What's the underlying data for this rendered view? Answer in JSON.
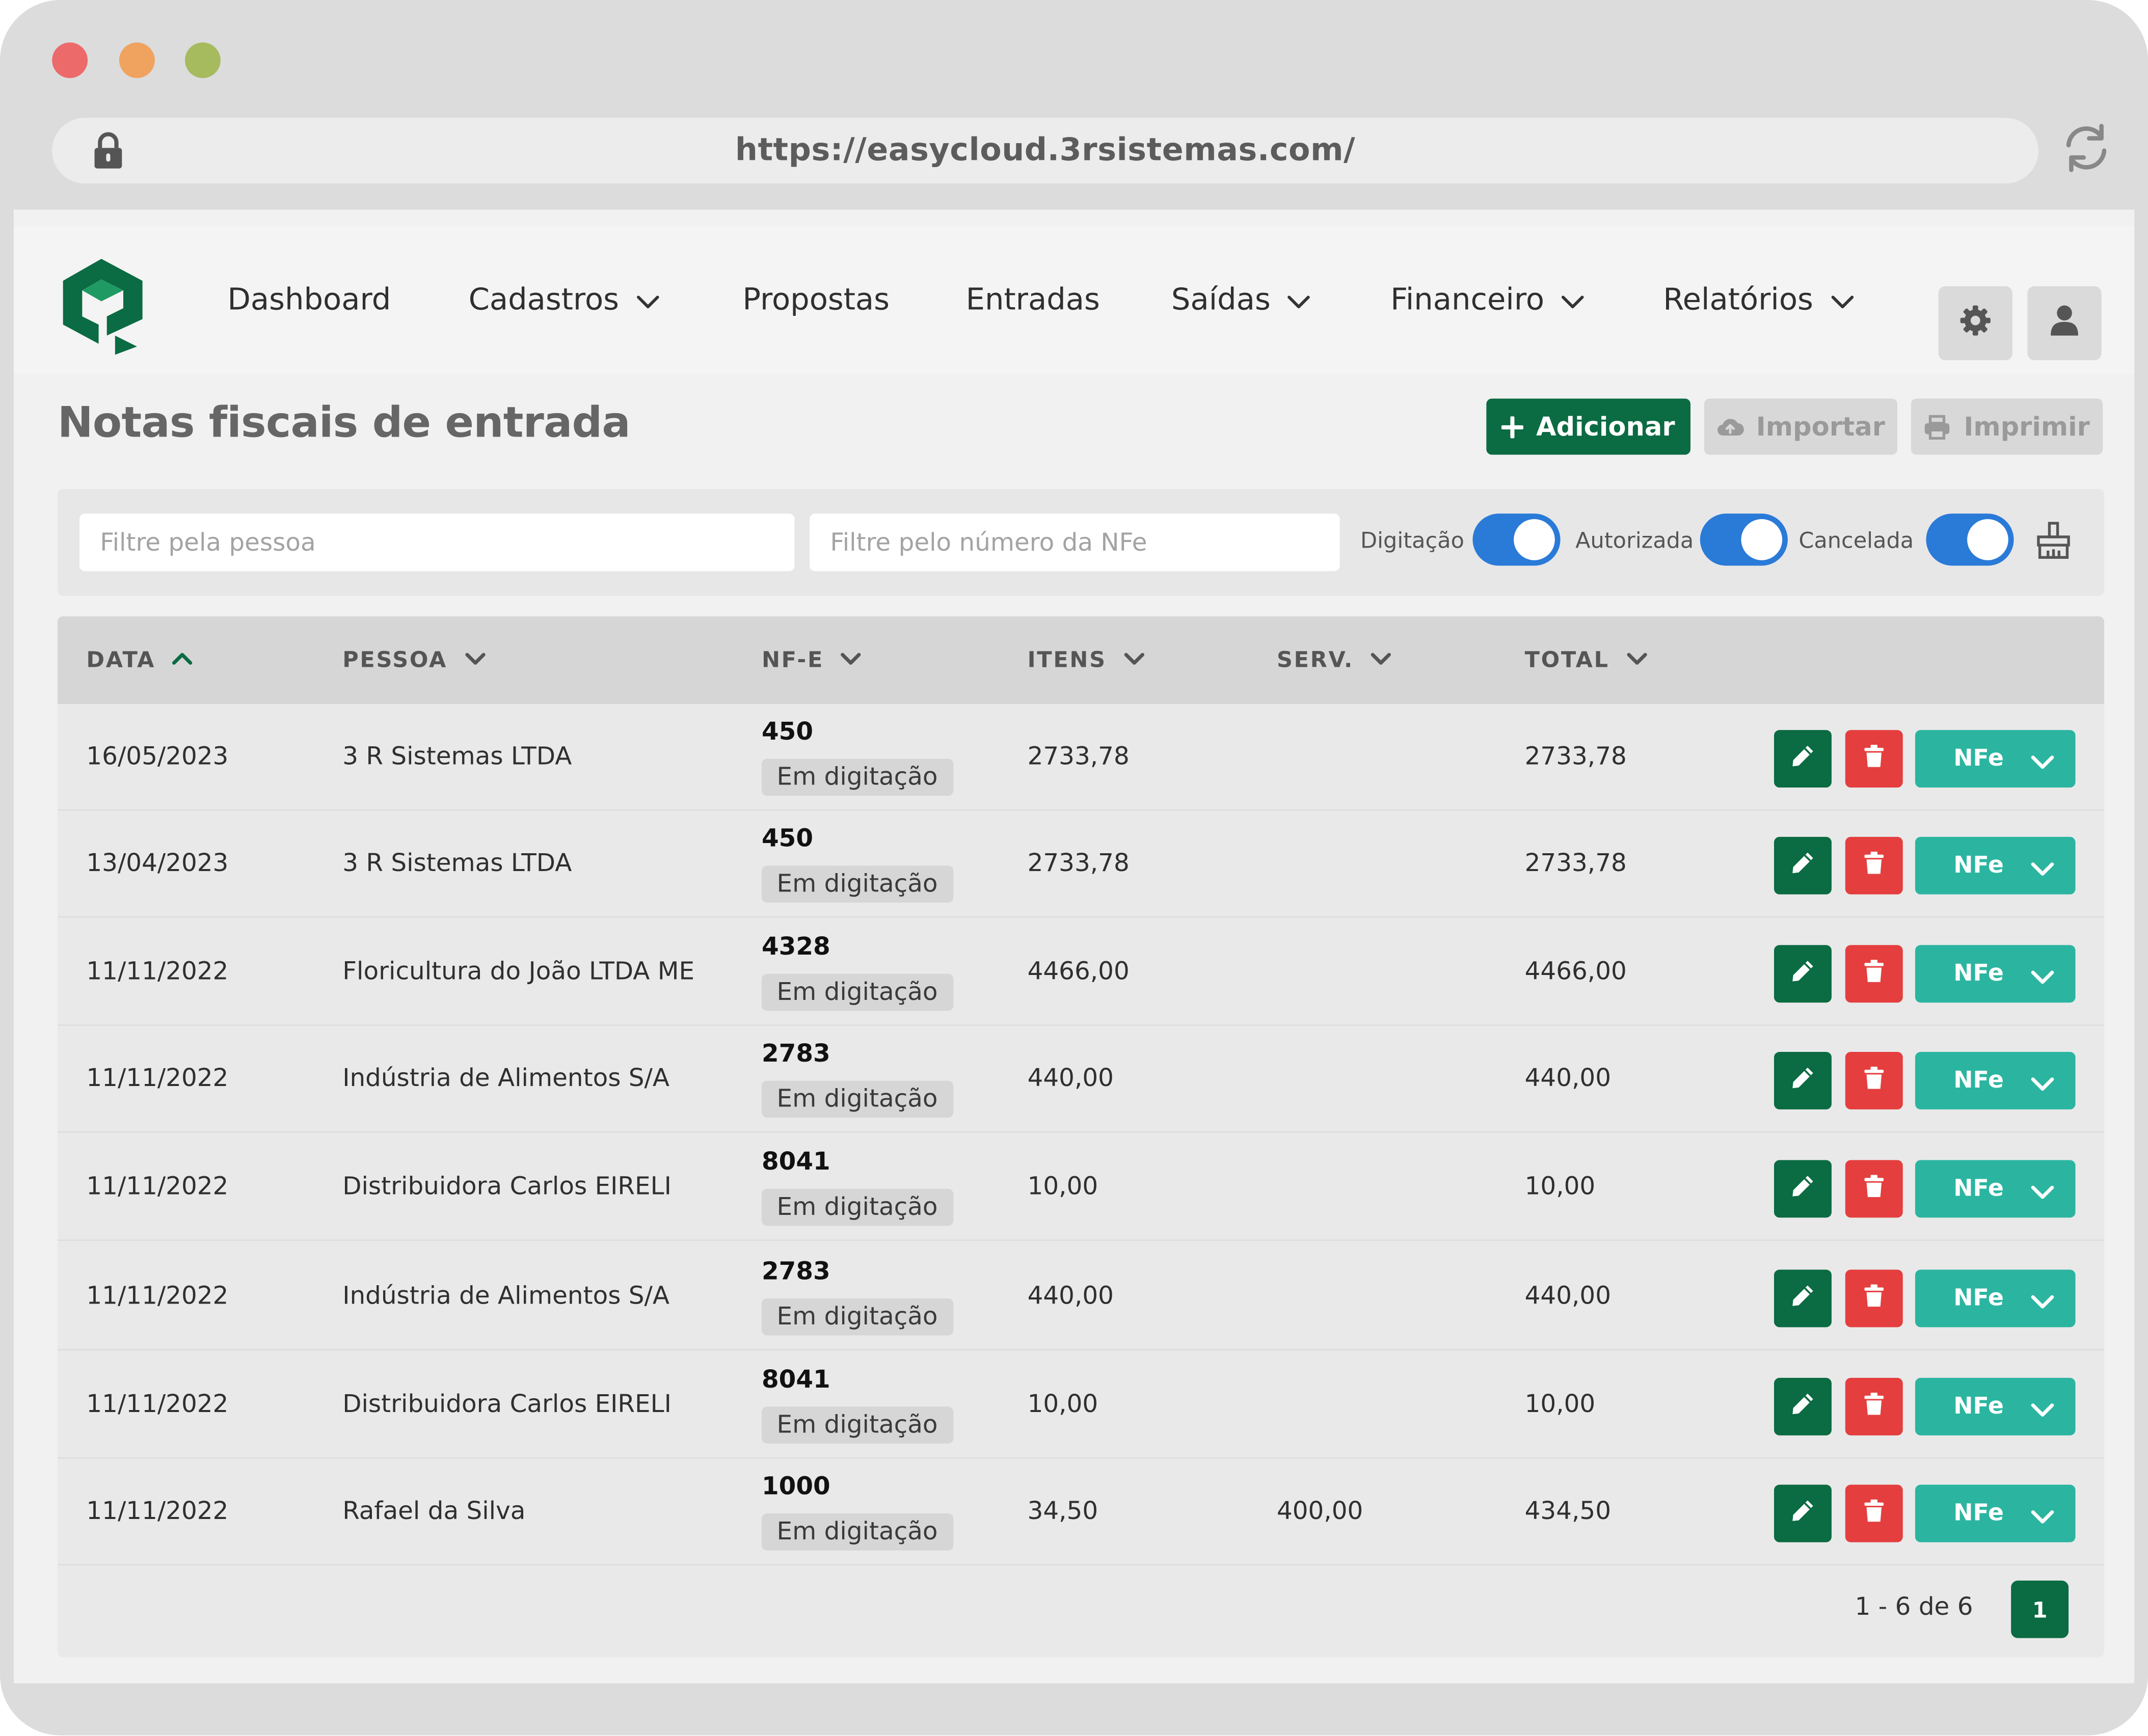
{
  "browser": {
    "url": "https://easycloud.3rsistemas.com/",
    "dots": [
      "#ec6a6a",
      "#f0a35f",
      "#a6ba5e"
    ]
  },
  "colors": {
    "primary": "#0b6b42",
    "danger": "#e53e3e",
    "teal": "#2bb5a0",
    "toggle": "#2a7ad8"
  },
  "nav": {
    "items": [
      {
        "label": "Dashboard",
        "dropdown": false
      },
      {
        "label": "Cadastros",
        "dropdown": true
      },
      {
        "label": "Propostas",
        "dropdown": false
      },
      {
        "label": "Entradas",
        "dropdown": false
      },
      {
        "label": "Saídas",
        "dropdown": true
      },
      {
        "label": "Financeiro",
        "dropdown": true
      },
      {
        "label": "Relatórios",
        "dropdown": true
      }
    ],
    "icons": [
      "gear-icon",
      "user-icon"
    ]
  },
  "page": {
    "title": "Notas fiscais de entrada",
    "add_label": "Adicionar",
    "import_label": "Importar",
    "print_label": "Imprimir"
  },
  "filters": {
    "person_placeholder": "Filtre pela pessoa",
    "nfe_placeholder": "Filtre pelo número da NFe",
    "toggles": [
      {
        "label": "Digitação",
        "on": true
      },
      {
        "label": "Autorizada",
        "on": true
      },
      {
        "label": "Cancelada",
        "on": true
      }
    ]
  },
  "table": {
    "headers": {
      "date": "DATA",
      "person": "PESSOA",
      "nfe": "NF-E",
      "items": "ITENS",
      "serv": "SERV.",
      "total": "TOTAL"
    },
    "rows": [
      {
        "date": "16/05/2023",
        "person": "3 R Sistemas LTDA",
        "nfe": "450",
        "status": "Em digitação",
        "items": "2733,78",
        "serv": "",
        "total": "2733,78",
        "action": "NFe"
      },
      {
        "date": "13/04/2023",
        "person": "3 R Sistemas LTDA",
        "nfe": "450",
        "status": "Em digitação",
        "items": "2733,78",
        "serv": "",
        "total": "2733,78",
        "action": "NFe"
      },
      {
        "date": "11/11/2022",
        "person": "Floricultura do João LTDA ME",
        "nfe": "4328",
        "status": "Em digitação",
        "items": "4466,00",
        "serv": "",
        "total": "4466,00",
        "action": "NFe"
      },
      {
        "date": "11/11/2022",
        "person": "Indústria de Alimentos S/A",
        "nfe": "2783",
        "status": "Em digitação",
        "items": "440,00",
        "serv": "",
        "total": "440,00",
        "action": "NFe"
      },
      {
        "date": "11/11/2022",
        "person": "Distribuidora Carlos EIRELI",
        "nfe": "8041",
        "status": "Em digitação",
        "items": "10,00",
        "serv": "",
        "total": "10,00",
        "action": "NFe"
      },
      {
        "date": "11/11/2022",
        "person": "Indústria de Alimentos S/A",
        "nfe": "2783",
        "status": "Em digitação",
        "items": "440,00",
        "serv": "",
        "total": "440,00",
        "action": "NFe"
      },
      {
        "date": "11/11/2022",
        "person": "Distribuidora Carlos EIRELI",
        "nfe": "8041",
        "status": "Em digitação",
        "items": "10,00",
        "serv": "",
        "total": "10,00",
        "action": "NFe"
      },
      {
        "date": "11/11/2022",
        "person": "Rafael da Silva",
        "nfe": "1000",
        "status": "Em digitação",
        "items": "34,50",
        "serv": "400,00",
        "total": "434,50",
        "action": "NFe"
      }
    ]
  },
  "pagination": {
    "summary": "1 - 6 de 6",
    "current_page": "1"
  }
}
